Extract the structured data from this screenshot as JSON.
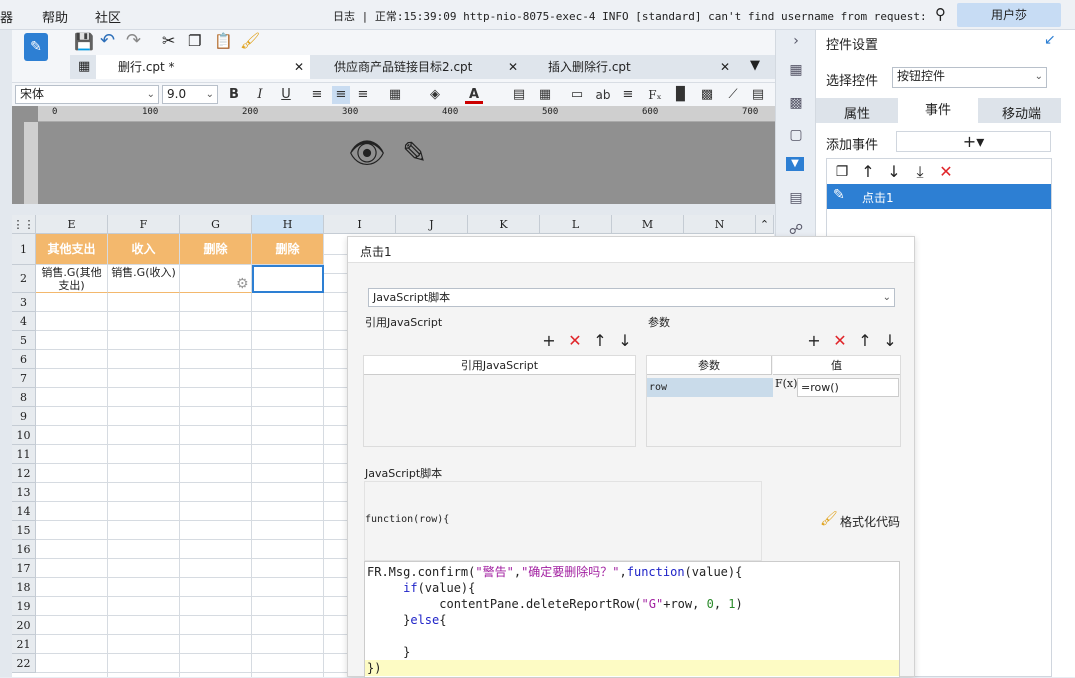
{
  "menu": {
    "item0": "器",
    "help": "帮助",
    "community": "社区",
    "log": "日志 | 正常:15:39:09 http-nio-8075-exec-4 INFO [standard] can't find username from request: JWT s...",
    "user": "用户莎"
  },
  "tabs": [
    {
      "label": "删行.cpt *"
    },
    {
      "label": "供应商产品链接目标2.cpt"
    },
    {
      "label": "插入删除行.cpt"
    }
  ],
  "format": {
    "font": "宋体",
    "size": "9.0"
  },
  "ruler": [
    "0",
    "100",
    "200",
    "300",
    "400",
    "500",
    "600",
    "700"
  ],
  "columns": [
    "E",
    "F",
    "G",
    "H",
    "I",
    "J",
    "K",
    "L",
    "M",
    "N"
  ],
  "rows": [
    "1",
    "2",
    "3",
    "4",
    "5",
    "6",
    "7",
    "8",
    "9",
    "10",
    "11",
    "12",
    "13",
    "14",
    "15",
    "16",
    "17",
    "18",
    "19",
    "20",
    "21",
    "22"
  ],
  "cells": {
    "e1": "其他支出",
    "f1": "收入",
    "g1": "删除",
    "h1": "删除",
    "e2": "销售.G(其他支出)",
    "f2": "销售.G(收入)"
  },
  "right_panel": {
    "title": "控件设置",
    "select_label": "选择控件",
    "select_value": "按钮控件",
    "tabs": [
      "属性",
      "事件",
      "移动端"
    ],
    "add_event": "添加事件",
    "event_item": "点击1"
  },
  "dialog": {
    "title": "点击1",
    "script_type": "JavaScript脚本",
    "ref_js_label": "引用JavaScript",
    "params_label": "参数",
    "ref_js_col": "引用JavaScript",
    "param_col": "参数",
    "value_col": "值",
    "param_name": "row",
    "param_value": "=row()",
    "fx": "F(x)",
    "script_label": "JavaScript脚本",
    "func_sig": "function(row){",
    "format_code": "格式化代码",
    "code_lines": [
      "FR.Msg.confirm(\"警告\",\"确定要删除吗？\",function(value){",
      "    if(value){",
      "        contentPane.deleteReportRow(\"G\"+row, 0, 1)",
      "    }else{",
      "",
      "    }",
      "})"
    ]
  }
}
